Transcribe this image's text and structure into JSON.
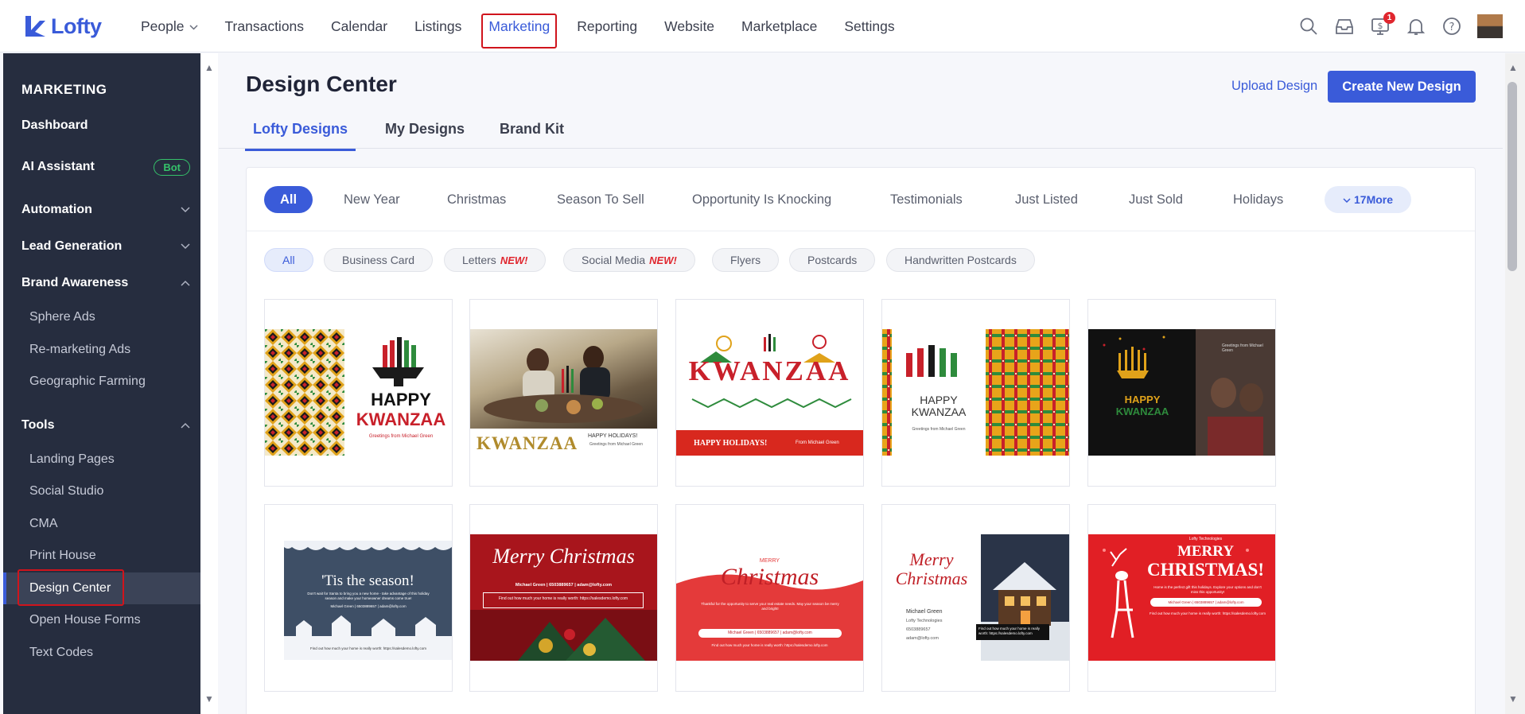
{
  "app": {
    "name": "Lofty"
  },
  "nav": [
    "People",
    "Transactions",
    "Calendar",
    "Listings",
    "Marketing",
    "Reporting",
    "Website",
    "Marketplace",
    "Settings"
  ],
  "notifications_badge": "1",
  "sidebar": {
    "title": "MARKETING",
    "dashboard": "Dashboard",
    "ai_assistant": "AI Assistant",
    "bot_badge": "Bot",
    "automation": "Automation",
    "lead_generation": "Lead Generation",
    "brand_awareness": "Brand Awareness",
    "brand_items": [
      "Sphere Ads",
      "Re-marketing Ads",
      "Geographic Farming"
    ],
    "tools": "Tools",
    "tool_items": [
      "Landing Pages",
      "Social Studio",
      "CMA",
      "Print House",
      "Design Center",
      "Open House Forms",
      "Text Codes"
    ]
  },
  "page": {
    "title": "Design Center",
    "upload_label": "Upload Design",
    "create_label": "Create New Design",
    "tabs": [
      "Lofty Designs",
      "My Designs",
      "Brand Kit"
    ]
  },
  "categories": [
    "All",
    "New Year",
    "Christmas",
    "Season To Sell",
    "Opportunity Is Knocking",
    "Testimonials",
    "Just Listed",
    "Just Sold",
    "Holidays"
  ],
  "more_label": "17More",
  "types": {
    "all": "All",
    "business_card": "Business Card",
    "letters": "Letters",
    "social_media": "Social Media",
    "new_tag": "NEW!",
    "flyers": "Flyers",
    "postcards": "Postcards",
    "handwritten": "Handwritten Postcards"
  },
  "cards": {
    "k1": {
      "line1": "HAPPY",
      "line2": "KWANZAA",
      "sub": "Greetings from Michael Green"
    },
    "k2": {
      "title": "KWANZAA",
      "greet": "HAPPY HOLIDAYS!",
      "sub": "Greetings from Michael Green"
    },
    "k3": {
      "title": "KWANZAA",
      "footer": "HAPPY HOLIDAYS!",
      "from": "From Michael Green"
    },
    "k4": {
      "line1": "HAPPY",
      "line2": "KWANZAA",
      "sub": "Greetings from Michael Green"
    },
    "k5": {
      "line1": "HAPPY",
      "line2": "KWANZAA",
      "greet": "Greetings from Michael Green"
    },
    "c1": {
      "title": "'Tis the season!",
      "body": "Don't wait for Santa to bring you a new home - take advantage of this holiday season and make your homeowner dreams come true!",
      "contact": "Michael Green | 6503889657 | adam@lofty.com",
      "footer": "Find out how much your home is really worth: https://salesdemo.lofty.com"
    },
    "c2": {
      "title": "Merry Christmas",
      "contact": "Michael Green | 6503889657 | adam@lofty.com",
      "box": "Find out how much your home is really worth: https://salesdemo.lofty.com"
    },
    "c3": {
      "top": "MERRY",
      "title": "Christmas",
      "body": "Thankful for the opportunity to serve your real estate needs. May your season be merry and bright!",
      "contact": "Michael Green | 6503889657 | adam@lofty.com",
      "footer": "Find out how much your home is really worth: https://salesdemo.lofty.com"
    },
    "c4": {
      "title1": "Merry",
      "title2": "Christmas",
      "name": "Michael Green",
      "company": "Lofty Technologies",
      "phone": "6503889657",
      "email": "adam@lofty.com",
      "cta": "Find out how much your home is really worth: https://salesdemo.lofty.com"
    },
    "c5": {
      "brand": "Lofty Technologies",
      "title1": "MERRY",
      "title2": "CHRISTMAS!",
      "body": "Home is the perfect gift this holidays. Explore your options and don't miss this opportunity!",
      "contact": "Michael Green | 6503889657 | adam@lofty.com",
      "footer": "Find out how much your home is really worth: https://salesdemo.lofty.com"
    }
  }
}
